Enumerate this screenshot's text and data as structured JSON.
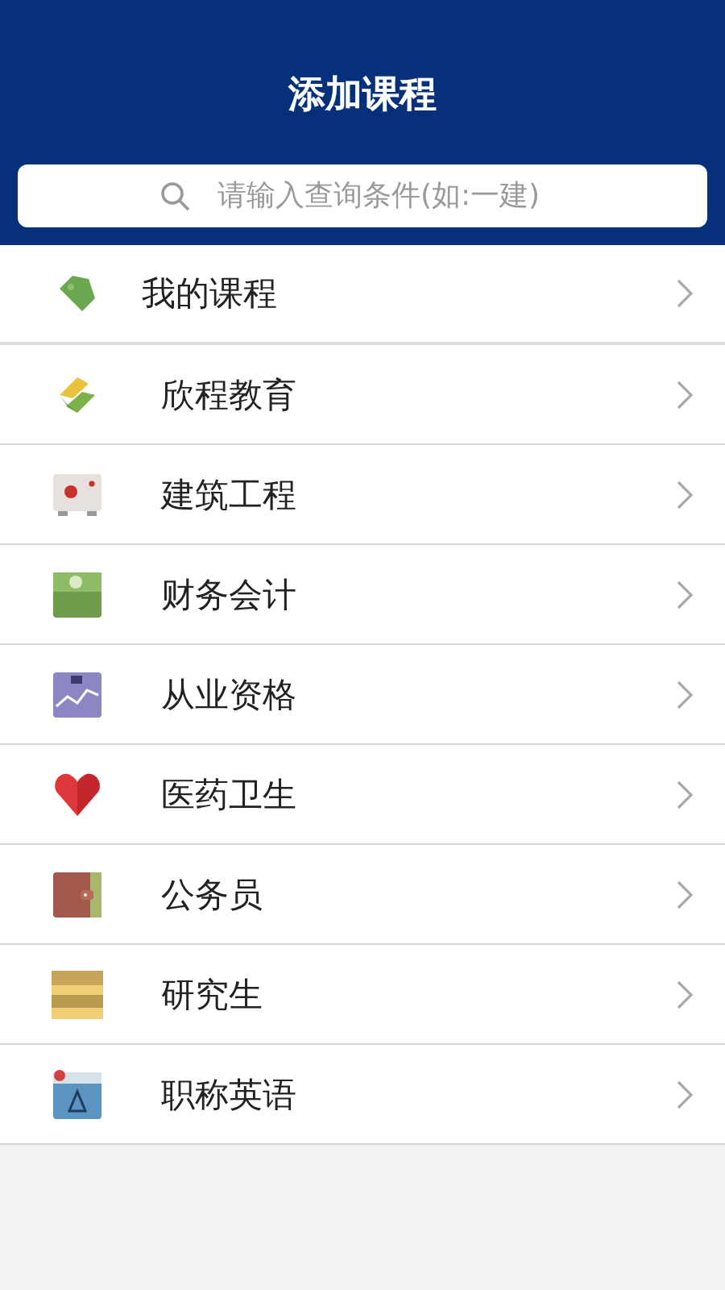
{
  "header": {
    "title": "添加课程"
  },
  "search": {
    "placeholder": "请输入查询条件(如:一建)"
  },
  "items": [
    {
      "label": "我的课程"
    },
    {
      "label": "欣程教育"
    },
    {
      "label": "建筑工程"
    },
    {
      "label": "财务会计"
    },
    {
      "label": "从业资格"
    },
    {
      "label": "医药卫生"
    },
    {
      "label": "公务员"
    },
    {
      "label": "研究生"
    },
    {
      "label": "职称英语"
    }
  ]
}
